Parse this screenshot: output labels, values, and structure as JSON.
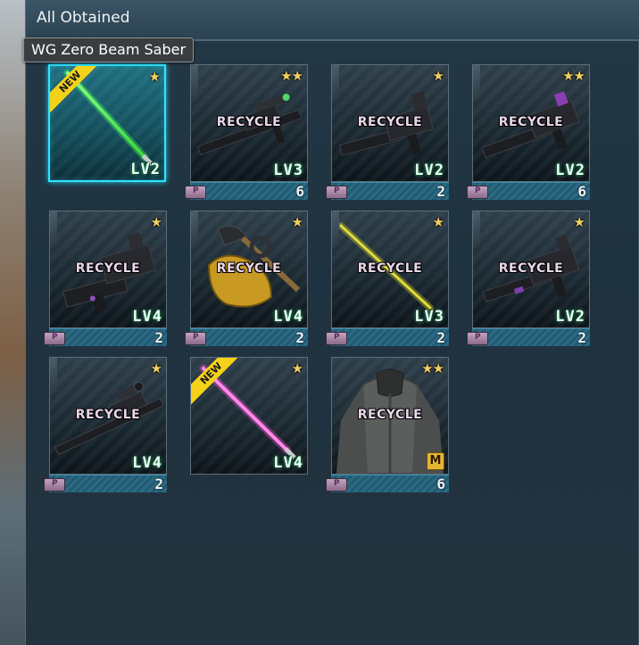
{
  "window": {
    "title": "All Obtained"
  },
  "tooltip": {
    "text": "WG Zero Beam Saber"
  },
  "items": [
    {
      "stars": "★",
      "level": "LV2",
      "count": "",
      "recycle": "",
      "new": "NEW",
      "icon": "green-beam-saber-icon",
      "selected": true
    },
    {
      "stars": "★★",
      "level": "LV3",
      "count": "6",
      "recycle": "RECYCLE",
      "icon": "sniper-rifle-icon"
    },
    {
      "stars": "★",
      "level": "LV2",
      "count": "2",
      "recycle": "RECYCLE",
      "icon": "beam-rifle-icon"
    },
    {
      "stars": "★★",
      "level": "LV2",
      "count": "6",
      "recycle": "RECYCLE",
      "icon": "beam-rifle-icon"
    },
    {
      "stars": "★",
      "level": "LV4",
      "count": "2",
      "recycle": "RECYCLE",
      "icon": "machine-gun-icon"
    },
    {
      "stars": "★",
      "level": "LV4",
      "count": "2",
      "recycle": "RECYCLE",
      "icon": "heat-hawk-icon"
    },
    {
      "stars": "★",
      "level": "LV3",
      "count": "2",
      "recycle": "RECYCLE",
      "icon": "yellow-beam-saber-icon"
    },
    {
      "stars": "★",
      "level": "LV2",
      "count": "2",
      "recycle": "RECYCLE",
      "icon": "beam-rifle-icon"
    },
    {
      "stars": "★",
      "level": "LV4",
      "count": "2",
      "recycle": "RECYCLE",
      "icon": "scoped-rifle-icon"
    },
    {
      "stars": "★",
      "level": "LV4",
      "count": "",
      "recycle": "",
      "new": "NEW",
      "icon": "pink-beam-saber-icon"
    },
    {
      "stars": "★★",
      "level": "",
      "count": "6",
      "recycle": "RECYCLE",
      "badge": "M",
      "icon": "pilot-suit-icon"
    }
  ],
  "colors": {
    "accent": "#2ee6ff",
    "star": "#f2cf63",
    "new_ribbon": "#f5d21a",
    "count_bar": "#2b6a84"
  }
}
